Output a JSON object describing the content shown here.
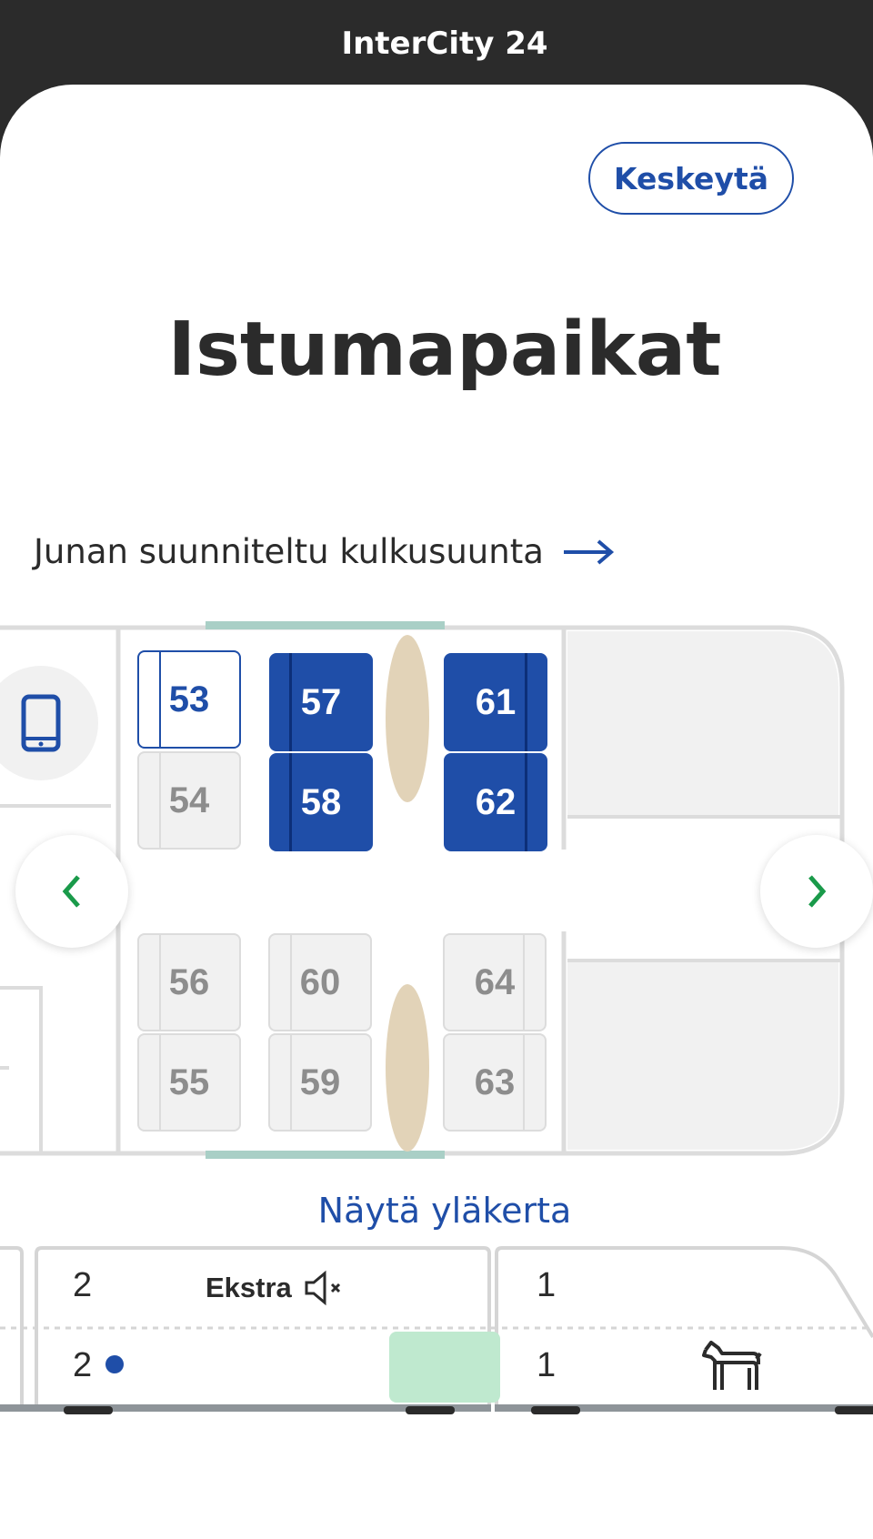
{
  "header": {
    "title": "InterCity 24"
  },
  "actions": {
    "cancel_label": "Keskeytä"
  },
  "page": {
    "title": "Istumapaikat"
  },
  "direction": {
    "label": "Junan suunniteltu kulkusuunta"
  },
  "seats": [
    {
      "number": "53",
      "state": "selected"
    },
    {
      "number": "54",
      "state": "free"
    },
    {
      "number": "57",
      "state": "taken"
    },
    {
      "number": "58",
      "state": "taken"
    },
    {
      "number": "61",
      "state": "taken"
    },
    {
      "number": "62",
      "state": "taken"
    },
    {
      "number": "56",
      "state": "free"
    },
    {
      "number": "55",
      "state": "free"
    },
    {
      "number": "60",
      "state": "free"
    },
    {
      "number": "59",
      "state": "free"
    },
    {
      "number": "64",
      "state": "free"
    },
    {
      "number": "63",
      "state": "free"
    }
  ],
  "upper_deck_link": "Näytä yläkerta",
  "train_overview": {
    "car_left": {
      "upper_number": "2",
      "lower_number": "2",
      "label": "Ekstra"
    },
    "car_right": {
      "upper_number": "1",
      "lower_number": "1"
    }
  },
  "icons": [
    "phone-icon",
    "arrow-right-icon",
    "chevron-left-icon",
    "chevron-right-icon",
    "mute-icon",
    "dog-icon"
  ],
  "colors": {
    "accent": "#1f4ea8",
    "nav_green": "#1a9a4a",
    "table": "#e2d3b8",
    "window": "#a9cfc6",
    "current_car": "#bfe9cf"
  }
}
